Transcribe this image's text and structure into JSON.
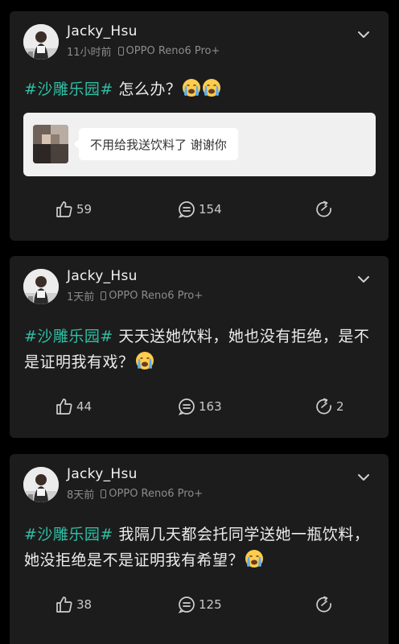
{
  "posts": [
    {
      "username": "Jacky_Hsu",
      "time": "11小时前",
      "device": "OPPO Reno6 Pro+",
      "hashtag": "#沙雕乐园#",
      "text": " 怎么办？",
      "emoji": [
        "crying-face-icon",
        "crying-face-icon"
      ],
      "quote_text": "不用给我送饮料了 谢谢你",
      "likes": "59",
      "comments": "154",
      "shares": ""
    },
    {
      "username": "Jacky_Hsu",
      "time": "1天前",
      "device": "OPPO Reno6 Pro+",
      "hashtag": "#沙雕乐园#",
      "text": " 天天送她饮料，她也没有拒绝，是不是证明我有戏？",
      "emoji": [
        "crying-face-icon"
      ],
      "likes": "44",
      "comments": "163",
      "shares": "2"
    },
    {
      "username": "Jacky_Hsu",
      "time": "8天前",
      "device": "OPPO Reno6 Pro+",
      "hashtag": "#沙雕乐园#",
      "text": " 我隔几天都会托同学送她一瓶饮料，她没拒绝是不是证明我有希望？",
      "emoji": [
        "crying-face-icon"
      ],
      "likes": "38",
      "comments": "125",
      "shares": ""
    }
  ],
  "colors": {
    "background": "#000000",
    "card": "#1c1c1c",
    "hashtag": "#2fbfa5",
    "meta": "#8c8c8c"
  }
}
